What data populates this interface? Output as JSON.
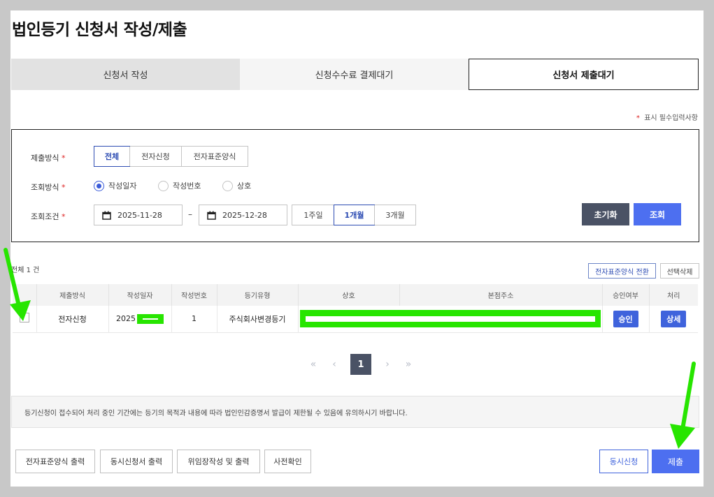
{
  "title": "법인등기 신청서 작성/제출",
  "tabs": [
    {
      "label": "신청서 작성"
    },
    {
      "label": "신청수수료 결제대기"
    },
    {
      "label": "신청서 제출대기"
    }
  ],
  "required_note": "표시 필수입력사항",
  "form": {
    "method_label": "제출방식",
    "method_options": [
      "전체",
      "전자신청",
      "전자표준양식"
    ],
    "lookup_label": "조회방식",
    "lookup_options": [
      "작성일자",
      "작성번호",
      "상호"
    ],
    "condition_label": "조회조건",
    "date_from": "2025-11-28",
    "date_sep": "–",
    "date_to": "2025-12-28",
    "period_options": [
      "1주일",
      "1개월",
      "3개월"
    ],
    "reset_label": "초기화",
    "search_label": "조회"
  },
  "list": {
    "total": "전체 1 건",
    "convert_label": "전자표준양식 전환",
    "delete_label": "선택삭제",
    "columns": [
      "제출방식",
      "작성일자",
      "작성번호",
      "등기유형",
      "상호",
      "본점주소",
      "승인여부",
      "처리"
    ],
    "rows": [
      {
        "method": "전자신청",
        "date": "2025",
        "number": "1",
        "type": "주식회사변경등기",
        "approve": "승인",
        "action": "상세"
      }
    ]
  },
  "pager": {
    "first": "«",
    "prev": "‹",
    "current": "1",
    "next": "›",
    "last": "»"
  },
  "notice": "등기신청이 접수되어 처리 중인 기간에는 등기의 목적과 내용에 따라 법인인감증명서 발급이 제한될 수 있음에 유의하시기 바랍니다.",
  "bottom": {
    "print_std": "전자표준양식 출력",
    "print_sim": "동시신청서 출력",
    "proxy": "위임장작성 및 출력",
    "precheck": "사전확인",
    "sim_apply": "동시신청",
    "submit": "제출"
  },
  "colors": {
    "accent": "#4d6ff0",
    "dark": "#4a5265",
    "highlight": "#27e500"
  }
}
